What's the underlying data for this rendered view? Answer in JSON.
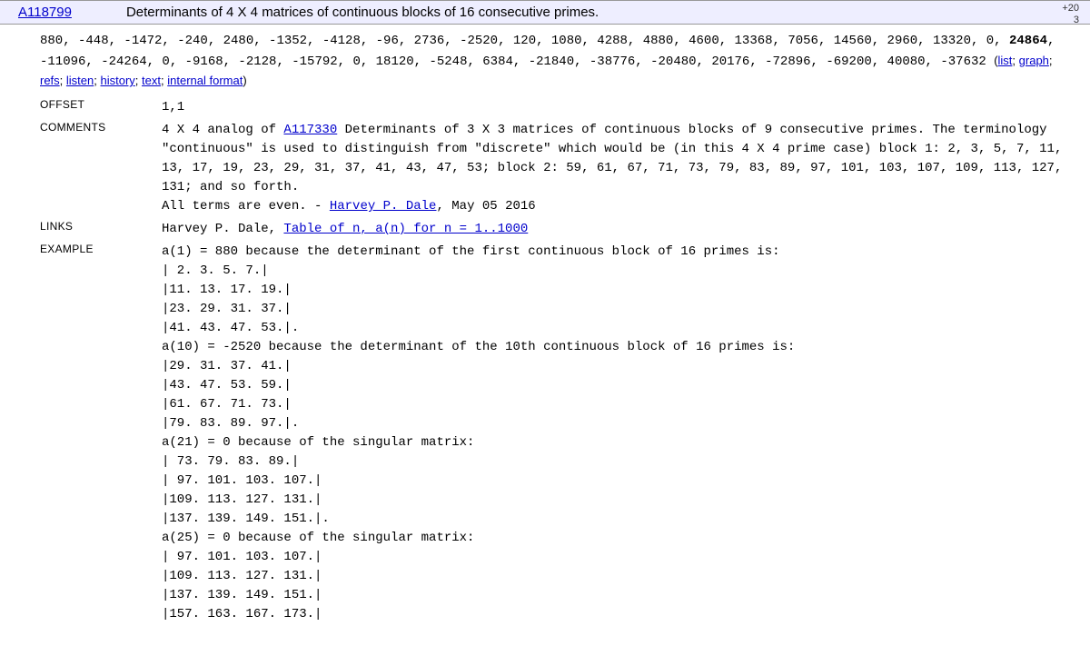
{
  "header": {
    "seq_id": "A118799",
    "title": "Determinants of 4 X 4 matrices of continuous blocks of 16 consecutive primes.",
    "vote_plus": "+20",
    "vote_count": "3"
  },
  "sequence": {
    "part1": "880, -448, -1472, -240, 2480, -1352, -4128, -96, 2736, -2520, 120, 1080, 4288, 4880, 4600, 13368, 7056, 14560, 2960, 13320, 0, ",
    "bold": "24864",
    "part2": ", -11096, -24264, 0, -9168, -2128, -15792, 0, 18120, -5248, 6384, -21840, -38776, -20480, 20176, -72896, -69200, 40080, -37632"
  },
  "links_bar": {
    "open": " (",
    "list": "list",
    "graph": "graph",
    "refs": "refs",
    "listen": "listen",
    "history": "history",
    "text": "text",
    "internal": "internal format",
    "close": ")",
    "sep": "; "
  },
  "sections": {
    "offset_label": "OFFSET",
    "offset_value": "1,1",
    "comments_label": "COMMENTS",
    "comments_line1a": "4 X 4 analog of ",
    "comments_ref": "A117330",
    "comments_line1b": " Determinants of 3 X 3 matrices of continuous blocks of 9 consecutive primes. The terminology \"continuous\" is used to distinguish from \"discrete\" which would be (in this 4 X 4 prime case) block 1: 2, 3, 5, 7, 11, 13, 17, 19, 23, 29, 31, 37, 41, 43, 47, 53; block 2: 59, 61, 67, 71, 73, 79, 83, 89, 97, 101, 103, 107, 109, 113, 127, 131; and so forth.",
    "comments_line2a": "All terms are even. - ",
    "comments_author": "Harvey P. Dale",
    "comments_line2b": ", May 05 2016",
    "links_label": "LINKS",
    "links_author": "Harvey P. Dale, ",
    "links_text": "Table of n, a(n) for n = 1..1000",
    "example_label": "EXAMPLE",
    "example_lines": [
      "a(1) = 880 because the determinant of the first continuous block of 16 primes is:",
      "| 2. 3. 5. 7.|",
      "|11. 13. 17. 19.|",
      "|23. 29. 31. 37.|",
      "|41. 43. 47. 53.|.",
      "a(10) = -2520 because the determinant of the 10th continuous block of 16 primes is:",
      "|29. 31. 37. 41.|",
      "|43. 47. 53. 59.|",
      "|61. 67. 71. 73.|",
      "|79. 83. 89. 97.|.",
      "a(21) = 0 because of the singular matrix:",
      "| 73. 79. 83. 89.|",
      "| 97. 101. 103. 107.|",
      "|109. 113. 127. 131.|",
      "|137. 139. 149. 151.|.",
      "a(25) = 0 because of the singular matrix:",
      "| 97. 101. 103. 107.|",
      "|109. 113. 127. 131.|",
      "|137. 139. 149. 151.|",
      "|157. 163. 167. 173.|"
    ]
  }
}
